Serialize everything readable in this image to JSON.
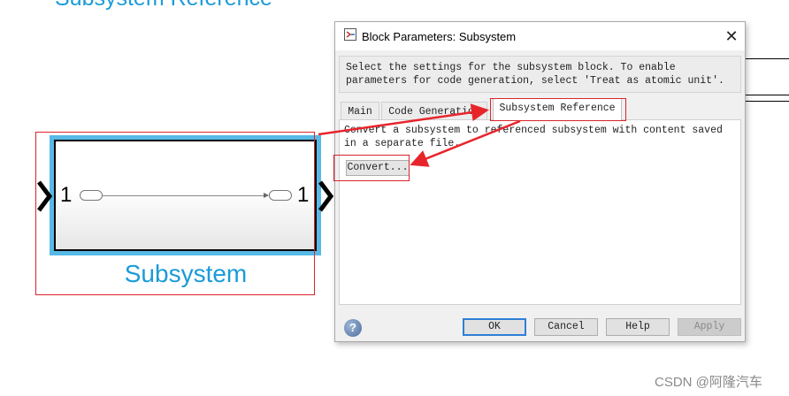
{
  "canvas": {
    "heading": "Subsystem Reference",
    "block_label": "Subsystem",
    "inport_number": "1",
    "outport_number": "1"
  },
  "dialog": {
    "title": "Block Parameters: Subsystem",
    "description": "Select the settings for the subsystem block. To enable parameters for code generation, select 'Treat as atomic unit'.",
    "tabs": [
      {
        "label": "Main"
      },
      {
        "label": "Code Generation"
      },
      {
        "label": "Subsystem Reference",
        "active": true
      }
    ],
    "panel_text": "Convert a subsystem to referenced subsystem with content saved in a separate file.",
    "convert_label": "Convert...",
    "buttons": {
      "ok": "OK",
      "cancel": "Cancel",
      "help": "Help",
      "apply": "Apply"
    }
  },
  "watermark": "CSDN @阿隆汽车",
  "colors": {
    "annotation_red": "#d9242b",
    "simulink_blue": "#1a9bd8",
    "selection_glow": "#58b9e6",
    "ok_border": "#2f7fd6"
  },
  "icons": {
    "title": "simulink-block-icon",
    "close": "close-icon",
    "help": "help-icon"
  }
}
